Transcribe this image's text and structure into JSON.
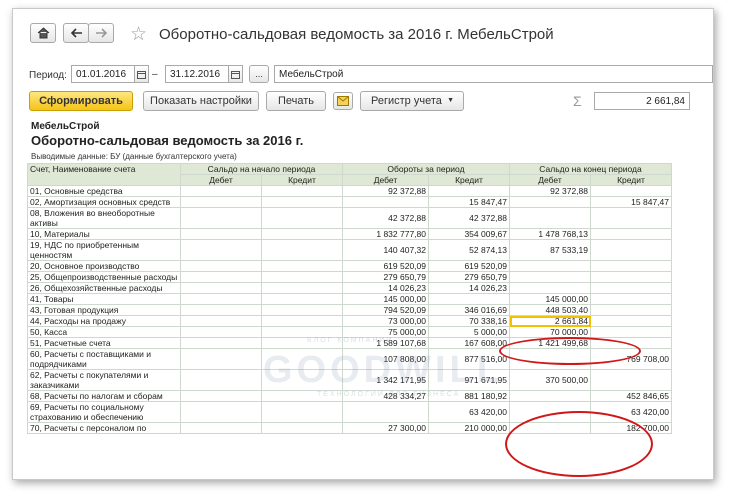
{
  "window": {
    "title": "Оборотно-сальдовая ведомость за 2016 г. МебельСтрой",
    "home_icon": "home-icon",
    "back_icon": "arrow-left-icon",
    "forward_icon": "arrow-right-icon",
    "favorite_icon": "star-icon"
  },
  "period": {
    "label": "Период:",
    "from": "01.01.2016",
    "dash": "–",
    "to": "31.12.2016",
    "more": "...",
    "organization": "МебельСтрой"
  },
  "toolbar": {
    "generate": "Сформировать",
    "show_settings": "Показать настройки",
    "print": "Печать",
    "register": "Регистр учета",
    "sum_symbol": "Σ",
    "sum_value": "2 661,84"
  },
  "report": {
    "org": "МебельСтрой",
    "title": "Оборотно-сальдовая ведомость за 2016 г.",
    "note": "Выводимые данные:  БУ (данные бухгалтерского учета)",
    "headers": {
      "account": "Счет, Наименование счета",
      "opening": "Сальдо на начало периода",
      "turnover": "Обороты за период",
      "closing": "Сальдо на конец периода",
      "debit": "Дебет",
      "credit": "Кредит"
    },
    "rows": [
      [
        "01, Основные средства",
        "",
        "",
        "92 372,88",
        "",
        "92 372,88",
        ""
      ],
      [
        "02, Амортизация основных средств",
        "",
        "",
        "",
        "15 847,47",
        "",
        "15 847,47"
      ],
      [
        "08, Вложения во внеоборотные активы",
        "",
        "",
        "42 372,88",
        "42 372,88",
        "",
        ""
      ],
      [
        "10, Материалы",
        "",
        "",
        "1 832 777,80",
        "354 009,67",
        "1 478 768,13",
        ""
      ],
      [
        "19, НДС по приобретенным ценностям",
        "",
        "",
        "140 407,32",
        "52 874,13",
        "87 533,19",
        ""
      ],
      [
        "20, Основное производство",
        "",
        "",
        "619 520,09",
        "619 520,09",
        "",
        ""
      ],
      [
        "25, Общепроизводственные расходы",
        "",
        "",
        "279 650,79",
        "279 650,79",
        "",
        ""
      ],
      [
        "26, Общехозяйственные расходы",
        "",
        "",
        "14 026,23",
        "14 026,23",
        "",
        ""
      ],
      [
        "41, Товары",
        "",
        "",
        "145 000,00",
        "",
        "145 000,00",
        ""
      ],
      [
        "43, Готовая продукция",
        "",
        "",
        "794 520,09",
        "346 016,69",
        "448 503,40",
        ""
      ],
      [
        "44, Расходы на продажу",
        "",
        "",
        "73 000,00",
        "70 338,16",
        "2 661,84",
        ""
      ],
      [
        "50, Касса",
        "",
        "",
        "75 000,00",
        "5 000,00",
        "70 000,00",
        ""
      ],
      [
        "51, Расчетные счета",
        "",
        "",
        "1 589 107,68",
        "167 608,00",
        "1 421 499,68",
        ""
      ],
      [
        "60, Расчеты с поставщиками и подрядчиками",
        "",
        "",
        "107 808,00",
        "877 516,00",
        "",
        "769 708,00"
      ],
      [
        "62, Расчеты с покупателями и заказчиками",
        "",
        "",
        "1 342 171,95",
        "971 671,95",
        "370 500,00",
        ""
      ],
      [
        "68, Расчеты по налогам и сборам",
        "",
        "",
        "428 334,27",
        "881 180,92",
        "",
        "452 846,65"
      ],
      [
        "69, Расчеты по социальному страхованию и обеспечению",
        "",
        "",
        "",
        "63 420,00",
        "",
        "63 420,00"
      ],
      [
        "70, Расчеты с персоналом по",
        "",
        "",
        "27 300,00",
        "210 000,00",
        "",
        "182 700,00"
      ]
    ]
  },
  "watermark": {
    "top": "БЛОГ КОМПАНИИ",
    "main": "GOODWILL",
    "bottom": "ТЕХНОЛОГИИ ДЛЯ БИЗНЕСА"
  },
  "annotation_color": "#d01818",
  "selection_color": "#f2c100"
}
